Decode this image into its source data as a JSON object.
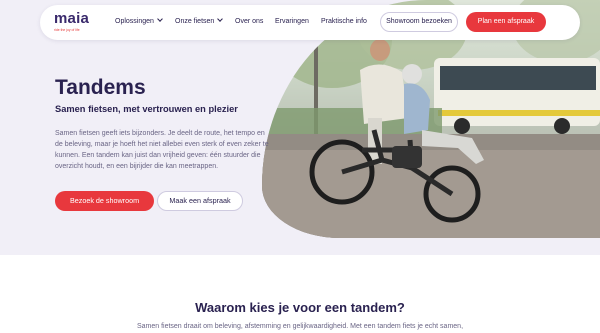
{
  "nav": {
    "logo": "maia",
    "logo_tagline": "ride the joy of life",
    "links": [
      "Oplossingen",
      "Onze fietsen",
      "Over ons",
      "Ervaringen",
      "Praktische info"
    ],
    "showroom_button": "Showroom bezoeken",
    "appointment_button": "Plan een afspraak"
  },
  "hero": {
    "title": "Tandems",
    "subtitle": "Samen fietsen, met vertrouwen en plezier",
    "body": "Samen fietsen geeft iets bijzonders. Je deelt de route, het tempo en de beleving, maar je hoeft het niet allebei even sterk of even zeker te kunnen. Een tandem kan juist dan vrijheid geven: één stuurder die overzicht houdt, en een bijrijder die kan meetrappen.",
    "primary_button": "Bezoek de showroom",
    "secondary_button": "Maak een afspraak"
  },
  "section": {
    "title": "Waarom kies je voor een tandem?",
    "text": "Samen fietsen draait om beleving, afstemming en gelijkwaardigheid. Met een tandem fiets je echt samen,"
  },
  "colors": {
    "accent": "#e8383d",
    "brand": "#2a2250",
    "hero_bg": "#f1eff7"
  }
}
